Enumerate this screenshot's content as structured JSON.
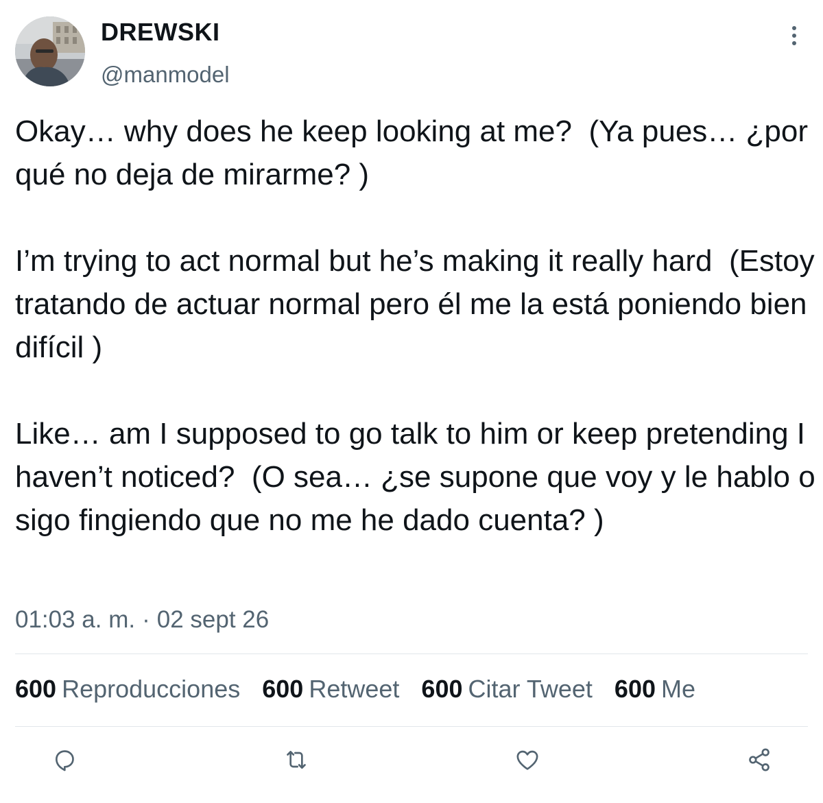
{
  "user": {
    "display_name": "DREWSKI",
    "handle": "@manmodel"
  },
  "tweet": {
    "paragraphs": [
      "Okay… why does he keep looking at me?  (Ya pues… ¿por qué no deja de mirarme? )",
      "I’m trying to act normal but he’s making it really hard  (Estoy tratando de actuar normal pero él me la está poniendo bien difícil )",
      "Like… am I supposed to go talk to him or keep pretending I haven’t noticed?  (O sea… ¿se supone que voy y le hablo o sigo fingiendo que no me he dado cuenta? )"
    ],
    "time": "01:03 a. m.",
    "separator": "·",
    "date": "02 sept 26"
  },
  "stats": [
    {
      "count": "600",
      "label": "Reproducciones"
    },
    {
      "count": "600",
      "label": "Retweet"
    },
    {
      "count": "600",
      "label": "Citar Tweet"
    },
    {
      "count": "600",
      "label": "Me"
    }
  ],
  "icons": {
    "more": "more-vertical-icon",
    "reply": "reply-icon",
    "retweet": "retweet-icon",
    "like": "heart-icon",
    "share": "share-icon"
  },
  "colors": {
    "text_primary": "#0f1419",
    "text_secondary": "#536471",
    "divider": "#e1e6ea"
  }
}
